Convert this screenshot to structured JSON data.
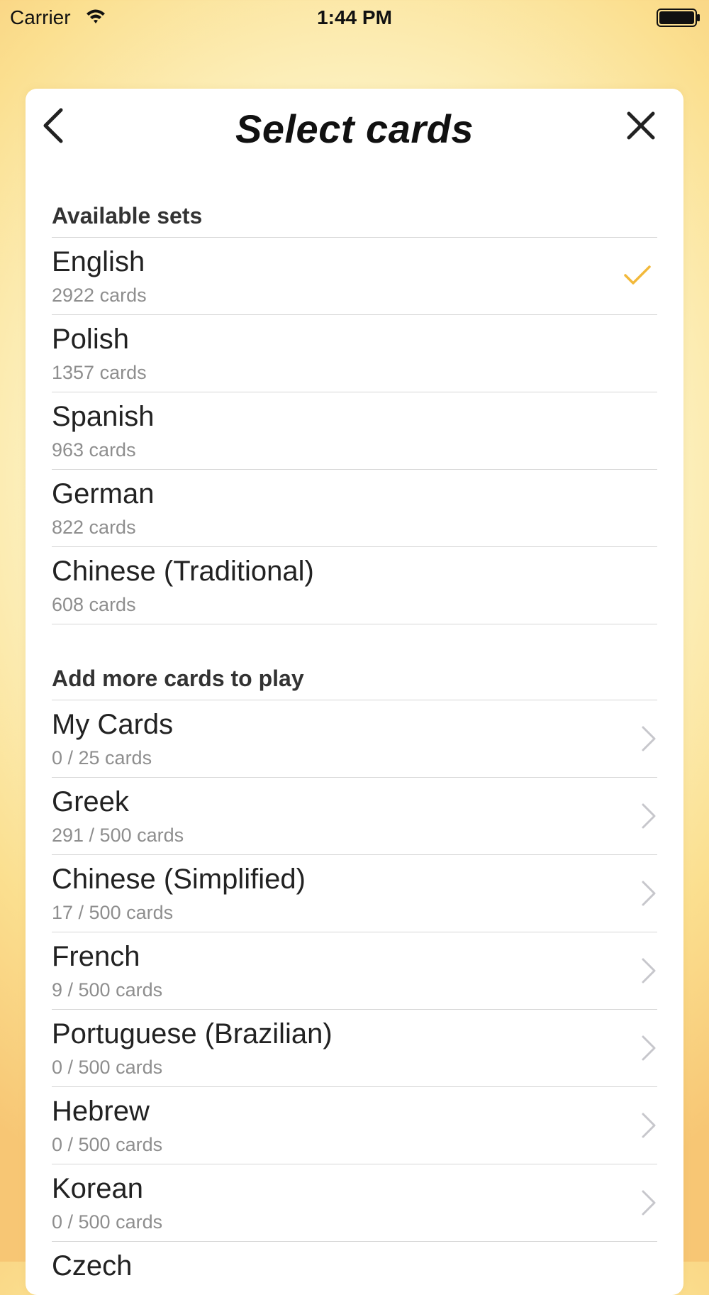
{
  "status_bar": {
    "carrier": "Carrier",
    "time": "1:44 PM"
  },
  "header": {
    "title": "Select cards",
    "back_icon": "chevron-left-icon",
    "close_icon": "close-icon"
  },
  "colors": {
    "accent_check": "#f2b93b",
    "chevron": "#c7c7cc",
    "separator": "#d6d6d6",
    "subtitle": "#8e8e8e"
  },
  "available_sets": {
    "title": "Available sets",
    "items": [
      {
        "name": "English",
        "count": "2922 cards",
        "selected": true
      },
      {
        "name": "Polish",
        "count": "1357 cards",
        "selected": false
      },
      {
        "name": "Spanish",
        "count": "963 cards",
        "selected": false
      },
      {
        "name": "German",
        "count": "822 cards",
        "selected": false
      },
      {
        "name": "Chinese (Traditional)",
        "count": "608 cards",
        "selected": false
      }
    ]
  },
  "more_sets": {
    "title": "Add more cards to play",
    "items": [
      {
        "name": "My Cards",
        "count": "0 / 25 cards"
      },
      {
        "name": "Greek",
        "count": "291 / 500 cards"
      },
      {
        "name": "Chinese (Simplified)",
        "count": "17 / 500 cards"
      },
      {
        "name": "French",
        "count": "9 / 500 cards"
      },
      {
        "name": "Portuguese (Brazilian)",
        "count": "0 / 500 cards"
      },
      {
        "name": "Hebrew",
        "count": "0 / 500 cards"
      },
      {
        "name": "Korean",
        "count": "0 / 500 cards"
      },
      {
        "name": "Czech",
        "count": ""
      }
    ]
  }
}
